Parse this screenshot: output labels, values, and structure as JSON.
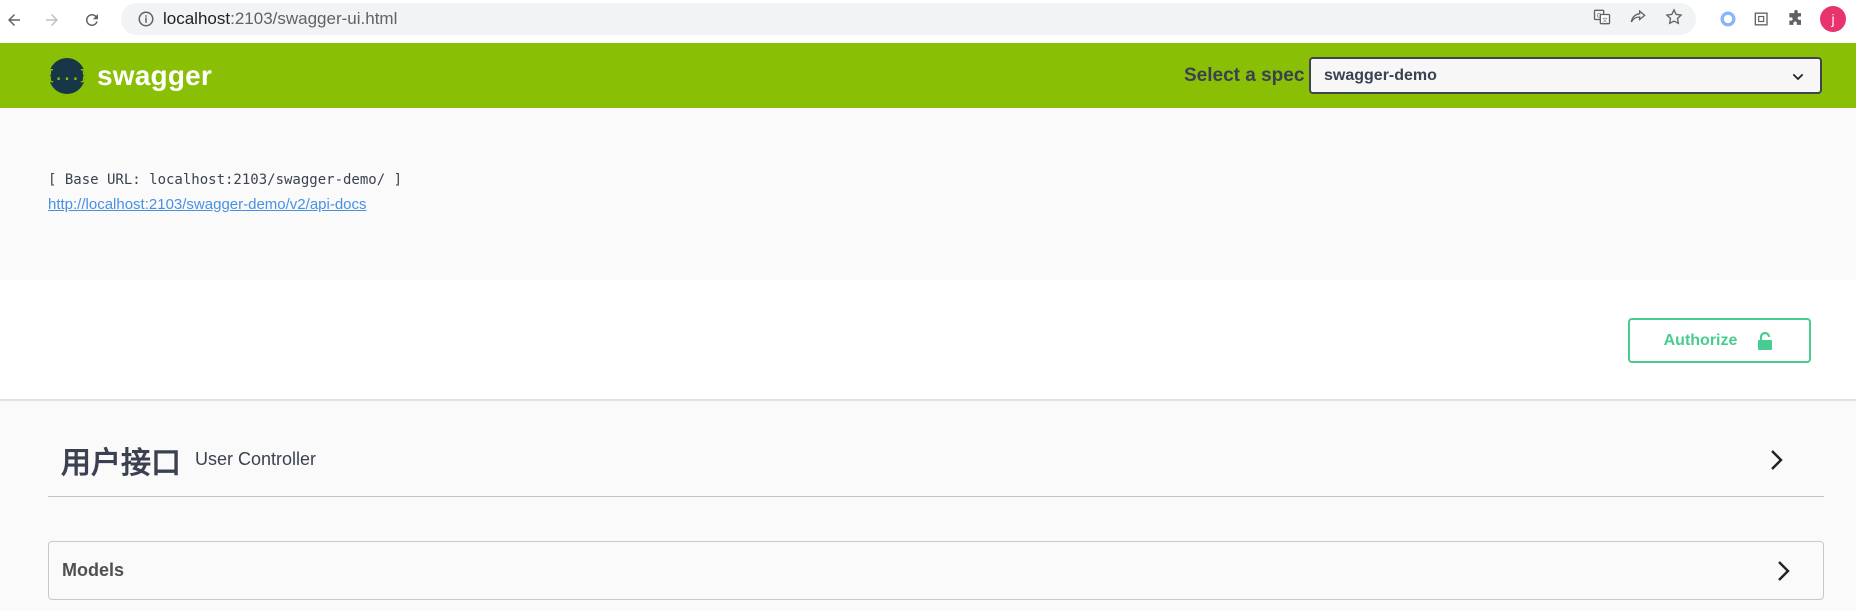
{
  "browser": {
    "url_host": "localhost",
    "url_path": ":2103/swagger-ui.html",
    "avatar_letter": "j"
  },
  "topbar": {
    "logo_text": "swagger",
    "logo_symbol": "{...}",
    "spec_label": "Select a spec",
    "spec_selected": "swagger-demo"
  },
  "info": {
    "base_url": "[ Base URL: localhost:2103/swagger-demo/ ]",
    "api_docs_link": "http://localhost:2103/swagger-demo/v2/api-docs"
  },
  "scheme": {
    "authorize_label": "Authorize"
  },
  "tags": [
    {
      "name": "用户接口",
      "description": "User Controller"
    }
  ],
  "models": {
    "title": "Models"
  },
  "colors": {
    "brand_green": "#89bf04",
    "authorize_green": "#49cc90",
    "link_blue": "#4990e2",
    "text_dark": "#3b4151"
  }
}
